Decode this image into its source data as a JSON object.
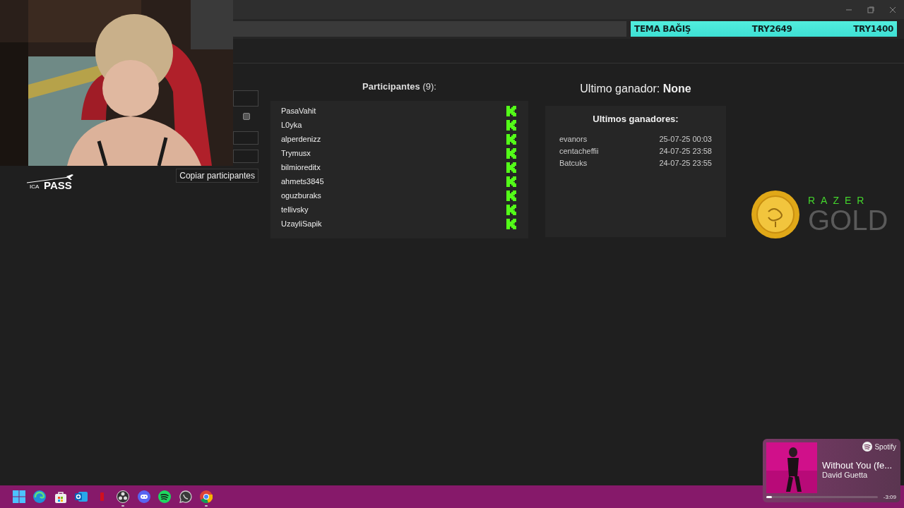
{
  "donation_bar": {
    "title": "TEMA BAĞIŞ",
    "center_value": "TRY2649",
    "right_value": "TRY1400"
  },
  "left_panel": {
    "checkbox": {
      "checked": false
    },
    "copy_button": "Copiar participantes"
  },
  "participants": {
    "title": "Participantes",
    "count": "(9):",
    "items": [
      {
        "name": "PasaVahit",
        "kind": "kick"
      },
      {
        "name": "L0yka",
        "kind": "kick"
      },
      {
        "name": "alperdenizz",
        "kind": "kick"
      },
      {
        "name": "Trymusx",
        "kind": "kick"
      },
      {
        "name": "bilmioreditx",
        "kind": "kick"
      },
      {
        "name": "ahmets3845",
        "kind": "kick"
      },
      {
        "name": "oguzburaks",
        "kind": "kick"
      },
      {
        "name": "tellivsky",
        "kind": "kick"
      },
      {
        "name": "UzayliSapik",
        "kind": "kick"
      }
    ]
  },
  "last_winner": {
    "label": "Ultimo ganador:",
    "value": "None"
  },
  "recent_winners": {
    "title": "Ultimos ganadores:",
    "rows": [
      {
        "name": "evanors",
        "time": "25-07-25 00:03"
      },
      {
        "name": "centacheffii",
        "time": "24-07-25 23:58"
      },
      {
        "name": "Batcuks",
        "time": "24-07-25 23:55"
      }
    ]
  },
  "pass_logo": {
    "small": "ICA",
    "big": "PASS"
  },
  "gold_logo": {
    "brand": "RAZER",
    "product": "GOLD"
  },
  "now_playing": {
    "source": "Spotify",
    "title": "Without You (fe...",
    "artist": "David Guetta",
    "remaining": "-3:09",
    "level": 0.05
  },
  "taskbar": {
    "apps": [
      {
        "kind": "windows",
        "running": false
      },
      {
        "kind": "browser",
        "running": false
      },
      {
        "kind": "store",
        "running": false
      },
      {
        "kind": "mail",
        "running": false
      },
      {
        "kind": "red",
        "running": false
      },
      {
        "kind": "camera",
        "running": true
      },
      {
        "kind": "chat",
        "running": false
      },
      {
        "kind": "music",
        "running": false
      },
      {
        "kind": "phone",
        "running": false
      },
      {
        "kind": "globe",
        "running": true
      }
    ]
  }
}
